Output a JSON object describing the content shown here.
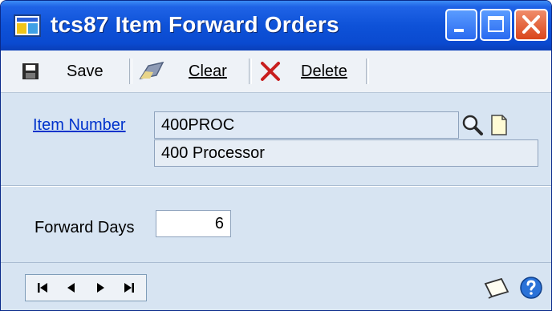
{
  "window": {
    "title": "tcs87 Item Forward Orders"
  },
  "titlebar_buttons": [
    "minimize-icon",
    "maximize-icon",
    "close-icon"
  ],
  "toolbar": {
    "save_label": "Save",
    "clear_label": "Clear",
    "delete_label": "Delete"
  },
  "form": {
    "item_number_label": "Item Number",
    "item_number_value": "400PROC",
    "item_description": "400 Processor",
    "forward_days_label": "Forward Days",
    "forward_days_value": "6"
  },
  "navigation": [
    "first-record-icon",
    "previous-record-icon",
    "next-record-icon",
    "last-record-icon"
  ],
  "status_icons": [
    "note-icon",
    "help-icon"
  ],
  "colors": {
    "titlebar": "#0a4ad0",
    "link": "#0033cc",
    "panel": "#d7e4f2",
    "close_button": "#d9461c"
  }
}
